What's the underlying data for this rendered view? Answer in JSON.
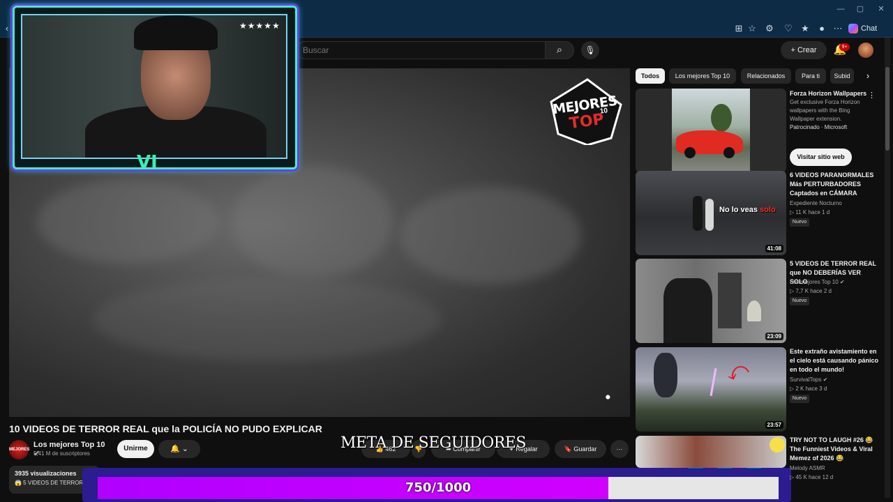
{
  "browser": {
    "chat_label": "Chat"
  },
  "header": {
    "search_placeholder": "Buscar",
    "create_label": "+ Crear",
    "notif_count": "9+"
  },
  "video": {
    "logo_line1": "MEJORES",
    "logo_line2": "TOP",
    "logo_line3": "10",
    "title": "10 VIDEOS DE TERROR REAL que la POLICÍA NO PUDO EXPLICAR"
  },
  "webcam": {
    "stars": "★★★★★",
    "badge": "VI"
  },
  "channel": {
    "avatar_text": "MEJORES",
    "name": "Los mejores Top 10",
    "subscribers": "5,41 M de suscriptores",
    "join_label": "Unirme"
  },
  "actions": {
    "like_count": "462",
    "share_label": "Compartir",
    "clip_label": "Regalar",
    "save_label": "Guardar"
  },
  "description": {
    "views": "3935 visualizaciones",
    "snippet": "😱 5 VIDEOS DE TERROR"
  },
  "goal": {
    "title": "META DE SEGUIDORES",
    "text": "750/1000",
    "progress": 0.75
  },
  "chips": [
    "Todos",
    "Los mejores Top 10",
    "Relacionados",
    "Para ti",
    "Subid"
  ],
  "sidebar": {
    "ad": {
      "title": "Forza Horizon Wallpapers",
      "desc": "Get exclusive Forza Horizon wallpapers with the Bing Wallpaper extension.",
      "sponsor": "Patrocinado · Microsoft",
      "visit_label": "Visitar sitio web"
    },
    "items": [
      {
        "title": "6 VIDEOS PARANORMALES Más PERTURBADORES Captados en CÁMARA",
        "channel": "Expediente Nocturno",
        "meta": "▷ 11 K   hace 1 d",
        "badge": "Nuevo",
        "duration": "41:08",
        "thumb_text": "No lo veas",
        "thumb_text_red": "solo"
      },
      {
        "title": "5 VIDEOS DE TERROR REAL que NO DEBERÍAS VER SOLO",
        "channel": "Los mejores Top 10 ✔",
        "meta": "▷ 7,7 K   hace 2 d",
        "badge": "Nuevo",
        "duration": "23:09"
      },
      {
        "title": "Este extraño avistamiento en el cielo está causando pánico en todo el mundo!",
        "channel": "SurvivalTops ✔",
        "meta": "▷ 2 K   hace 3 d",
        "badge": "Nuevo",
        "duration": "23:57"
      },
      {
        "title": "TRY NOT TO LAUGH #26 😂 The Funniest Videos & Viral Memez of 2026 😂",
        "channel": "Melody ASMR",
        "meta": "▷ 45 K   hace 12 d"
      }
    ]
  }
}
